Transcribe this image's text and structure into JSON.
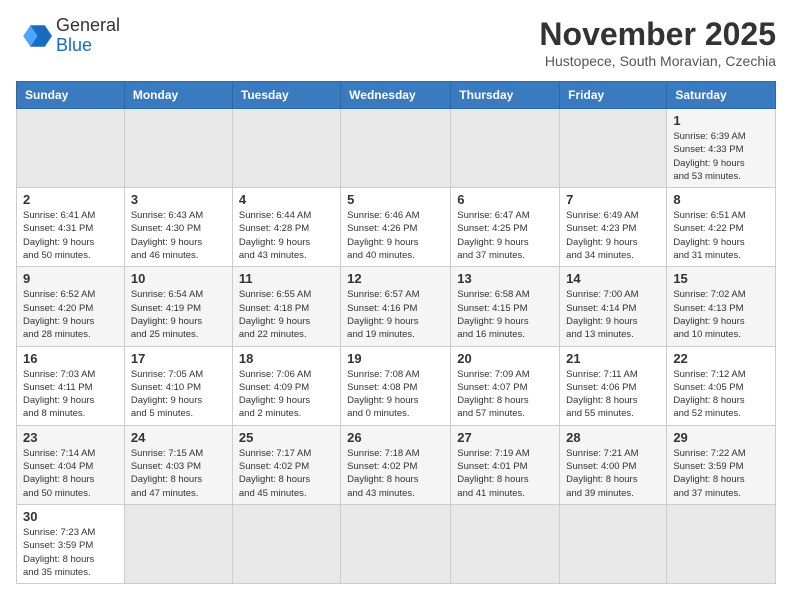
{
  "header": {
    "logo_line1": "General",
    "logo_line2": "Blue",
    "month_title": "November 2025",
    "location": "Hustopece, South Moravian, Czechia"
  },
  "weekdays": [
    "Sunday",
    "Monday",
    "Tuesday",
    "Wednesday",
    "Thursday",
    "Friday",
    "Saturday"
  ],
  "weeks": [
    [
      {
        "day": "",
        "info": ""
      },
      {
        "day": "",
        "info": ""
      },
      {
        "day": "",
        "info": ""
      },
      {
        "day": "",
        "info": ""
      },
      {
        "day": "",
        "info": ""
      },
      {
        "day": "",
        "info": ""
      },
      {
        "day": "1",
        "info": "Sunrise: 6:39 AM\nSunset: 4:33 PM\nDaylight: 9 hours\nand 53 minutes."
      }
    ],
    [
      {
        "day": "2",
        "info": "Sunrise: 6:41 AM\nSunset: 4:31 PM\nDaylight: 9 hours\nand 50 minutes."
      },
      {
        "day": "3",
        "info": "Sunrise: 6:43 AM\nSunset: 4:30 PM\nDaylight: 9 hours\nand 46 minutes."
      },
      {
        "day": "4",
        "info": "Sunrise: 6:44 AM\nSunset: 4:28 PM\nDaylight: 9 hours\nand 43 minutes."
      },
      {
        "day": "5",
        "info": "Sunrise: 6:46 AM\nSunset: 4:26 PM\nDaylight: 9 hours\nand 40 minutes."
      },
      {
        "day": "6",
        "info": "Sunrise: 6:47 AM\nSunset: 4:25 PM\nDaylight: 9 hours\nand 37 minutes."
      },
      {
        "day": "7",
        "info": "Sunrise: 6:49 AM\nSunset: 4:23 PM\nDaylight: 9 hours\nand 34 minutes."
      },
      {
        "day": "8",
        "info": "Sunrise: 6:51 AM\nSunset: 4:22 PM\nDaylight: 9 hours\nand 31 minutes."
      }
    ],
    [
      {
        "day": "9",
        "info": "Sunrise: 6:52 AM\nSunset: 4:20 PM\nDaylight: 9 hours\nand 28 minutes."
      },
      {
        "day": "10",
        "info": "Sunrise: 6:54 AM\nSunset: 4:19 PM\nDaylight: 9 hours\nand 25 minutes."
      },
      {
        "day": "11",
        "info": "Sunrise: 6:55 AM\nSunset: 4:18 PM\nDaylight: 9 hours\nand 22 minutes."
      },
      {
        "day": "12",
        "info": "Sunrise: 6:57 AM\nSunset: 4:16 PM\nDaylight: 9 hours\nand 19 minutes."
      },
      {
        "day": "13",
        "info": "Sunrise: 6:58 AM\nSunset: 4:15 PM\nDaylight: 9 hours\nand 16 minutes."
      },
      {
        "day": "14",
        "info": "Sunrise: 7:00 AM\nSunset: 4:14 PM\nDaylight: 9 hours\nand 13 minutes."
      },
      {
        "day": "15",
        "info": "Sunrise: 7:02 AM\nSunset: 4:13 PM\nDaylight: 9 hours\nand 10 minutes."
      }
    ],
    [
      {
        "day": "16",
        "info": "Sunrise: 7:03 AM\nSunset: 4:11 PM\nDaylight: 9 hours\nand 8 minutes."
      },
      {
        "day": "17",
        "info": "Sunrise: 7:05 AM\nSunset: 4:10 PM\nDaylight: 9 hours\nand 5 minutes."
      },
      {
        "day": "18",
        "info": "Sunrise: 7:06 AM\nSunset: 4:09 PM\nDaylight: 9 hours\nand 2 minutes."
      },
      {
        "day": "19",
        "info": "Sunrise: 7:08 AM\nSunset: 4:08 PM\nDaylight: 9 hours\nand 0 minutes."
      },
      {
        "day": "20",
        "info": "Sunrise: 7:09 AM\nSunset: 4:07 PM\nDaylight: 8 hours\nand 57 minutes."
      },
      {
        "day": "21",
        "info": "Sunrise: 7:11 AM\nSunset: 4:06 PM\nDaylight: 8 hours\nand 55 minutes."
      },
      {
        "day": "22",
        "info": "Sunrise: 7:12 AM\nSunset: 4:05 PM\nDaylight: 8 hours\nand 52 minutes."
      }
    ],
    [
      {
        "day": "23",
        "info": "Sunrise: 7:14 AM\nSunset: 4:04 PM\nDaylight: 8 hours\nand 50 minutes."
      },
      {
        "day": "24",
        "info": "Sunrise: 7:15 AM\nSunset: 4:03 PM\nDaylight: 8 hours\nand 47 minutes."
      },
      {
        "day": "25",
        "info": "Sunrise: 7:17 AM\nSunset: 4:02 PM\nDaylight: 8 hours\nand 45 minutes."
      },
      {
        "day": "26",
        "info": "Sunrise: 7:18 AM\nSunset: 4:02 PM\nDaylight: 8 hours\nand 43 minutes."
      },
      {
        "day": "27",
        "info": "Sunrise: 7:19 AM\nSunset: 4:01 PM\nDaylight: 8 hours\nand 41 minutes."
      },
      {
        "day": "28",
        "info": "Sunrise: 7:21 AM\nSunset: 4:00 PM\nDaylight: 8 hours\nand 39 minutes."
      },
      {
        "day": "29",
        "info": "Sunrise: 7:22 AM\nSunset: 3:59 PM\nDaylight: 8 hours\nand 37 minutes."
      }
    ],
    [
      {
        "day": "30",
        "info": "Sunrise: 7:23 AM\nSunset: 3:59 PM\nDaylight: 8 hours\nand 35 minutes."
      },
      {
        "day": "",
        "info": ""
      },
      {
        "day": "",
        "info": ""
      },
      {
        "day": "",
        "info": ""
      },
      {
        "day": "",
        "info": ""
      },
      {
        "day": "",
        "info": ""
      },
      {
        "day": "",
        "info": ""
      }
    ]
  ]
}
